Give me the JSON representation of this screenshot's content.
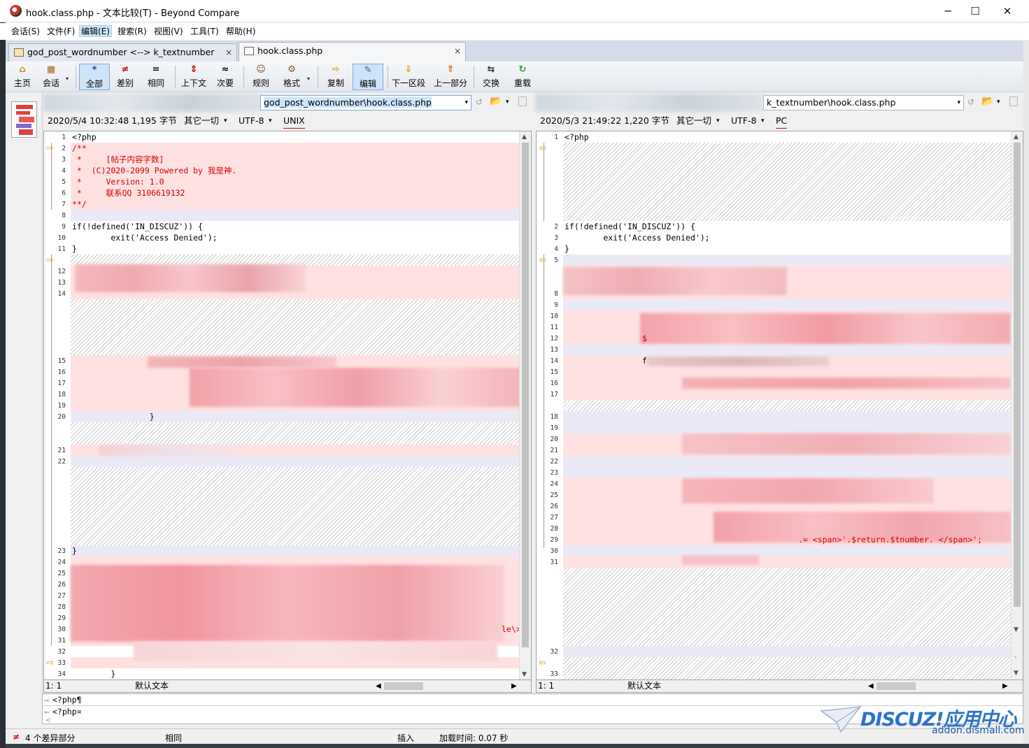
{
  "window": {
    "title": "hook.class.php - 文本比较(T) - Beyond Compare",
    "minimize": "─",
    "maximize": "☐",
    "close": "✕"
  },
  "menu": [
    "会话(S)",
    "文件(F)",
    "编辑(E)",
    "搜索(R)",
    "视图(V)",
    "工具(T)",
    "帮助(H)"
  ],
  "tabs": [
    {
      "label": "god_post_wordnumber <--> k_textnumber",
      "active": false
    },
    {
      "label": "hook.class.php",
      "active": true
    }
  ],
  "tab_close": "×",
  "toolbar": {
    "home": "主页",
    "session": "会话",
    "all": "全部",
    "diff": "差别",
    "same": "相同",
    "context": "上下文",
    "minor": "次要",
    "rules": "规则",
    "format": "格式",
    "copy": "复制",
    "edit": "编辑",
    "next": "下一区段",
    "prev": "上一部分",
    "swap": "交换",
    "reload": "重载"
  },
  "icons": {
    "home": "⌂",
    "session": "▦",
    "all": "*",
    "diff": "≠",
    "same": "=",
    "context": "⇕",
    "minor": "≈",
    "rules": "☺",
    "format": "⚙",
    "copy": "⇨",
    "edit": "✎",
    "next": "⇓",
    "prev": "⇑",
    "swap": "⇆",
    "reload": "↻",
    "folder": "📂",
    "dropdown": "▾"
  },
  "left": {
    "path": "god_post_wordnumber\\hook.class.php",
    "date": "2020/5/4 10:32:48",
    "size": "1,195 字节",
    "mode": "其它一切",
    "encoding": "UTF-8",
    "lineend": "UNIX",
    "cursor": "1: 1",
    "format": "默认文本"
  },
  "right": {
    "path": "k_textnumber\\hook.class.php",
    "date": "2020/5/3 21:49:22",
    "size": "1,220 字节",
    "mode": "其它一切",
    "encoding": "UTF-8",
    "lineend": "PC",
    "cursor": "1: 1",
    "format": "默认文本"
  },
  "left_code": {
    "l1": "<?php",
    "l2": "/**",
    "l3": " *     [帖子内容字数]",
    "l4": " *  (C)2020-2099 Powered by 我是神.",
    "l5": " *     Version: 1.0",
    "l6": " *     联系QQ 3106619132",
    "l7": "**/",
    "l9": "if(!defined('IN_DISCUZ')) {",
    "l10": "        exit('Access Denied');",
    "l11": "}",
    "l20": "                }",
    "l23": "}",
    "l30": "le\\>",
    "l34": "        }"
  },
  "right_code": {
    "l1": "<?php",
    "l2": "if(!defined('IN_DISCUZ')) {",
    "l3": "        exit('Access Denied');",
    "l4": "}",
    "l12": "$",
    "l14": "f",
    "l29": ".=  <span>'.$return.$tnumber. </span>';"
  },
  "line_compare": {
    "top": "<?php¶",
    "bottom": "<?php¤"
  },
  "status": {
    "diffs": "4 个差异部分",
    "same": "相同",
    "insert": "插入",
    "load": "加载时间: 0.07 秒"
  },
  "watermark": {
    "brand": "DISCUZ!应用中心",
    "url": "addon.dismall.com"
  }
}
